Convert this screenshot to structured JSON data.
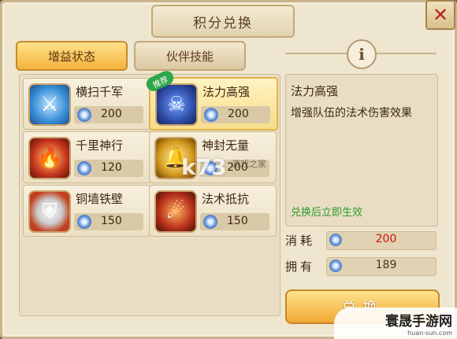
{
  "title": "积分兑换",
  "close_symbol": "✕",
  "tabs": [
    {
      "label": "增益状态",
      "active": true
    },
    {
      "label": "伙伴技能",
      "active": false
    }
  ],
  "info_symbol": "i",
  "skills": [
    {
      "name": "横扫千军",
      "cost": "200",
      "icon": "sword-sweep-icon",
      "color": "#3a8fd8",
      "selected": false
    },
    {
      "name": "法力高强",
      "cost": "200",
      "icon": "skull-mana-icon",
      "color": "#2f4ea8",
      "selected": true,
      "badge": "推荐"
    },
    {
      "name": "千里神行",
      "cost": "120",
      "icon": "phoenix-icon",
      "color": "#c8361e",
      "selected": false
    },
    {
      "name": "神封无量",
      "cost": "200",
      "icon": "golden-bell-icon",
      "color": "#d49a1e",
      "selected": false
    },
    {
      "name": "铜墙铁壁",
      "cost": "150",
      "icon": "shield-icon",
      "color": "#c2401f",
      "selected": false
    },
    {
      "name": "法术抵抗",
      "cost": "150",
      "icon": "fire-spirit-icon",
      "color": "#b8311c",
      "selected": false
    }
  ],
  "detail": {
    "title": "法力高强",
    "description": "增强队伍的法术伤害效果",
    "note": "兑换后立即生效"
  },
  "stats": {
    "cost_label": "消耗",
    "cost_value": "200",
    "cost_color": "#d2120f",
    "own_label": "拥有",
    "own_value": "189",
    "own_color": "#4a3218"
  },
  "exchange_button": "兑换",
  "overlay": {
    "k73": "k73",
    "k73_sub": "游戏之家",
    "brand": "寰晟手游网",
    "brand_url": "huan-sun.com"
  }
}
